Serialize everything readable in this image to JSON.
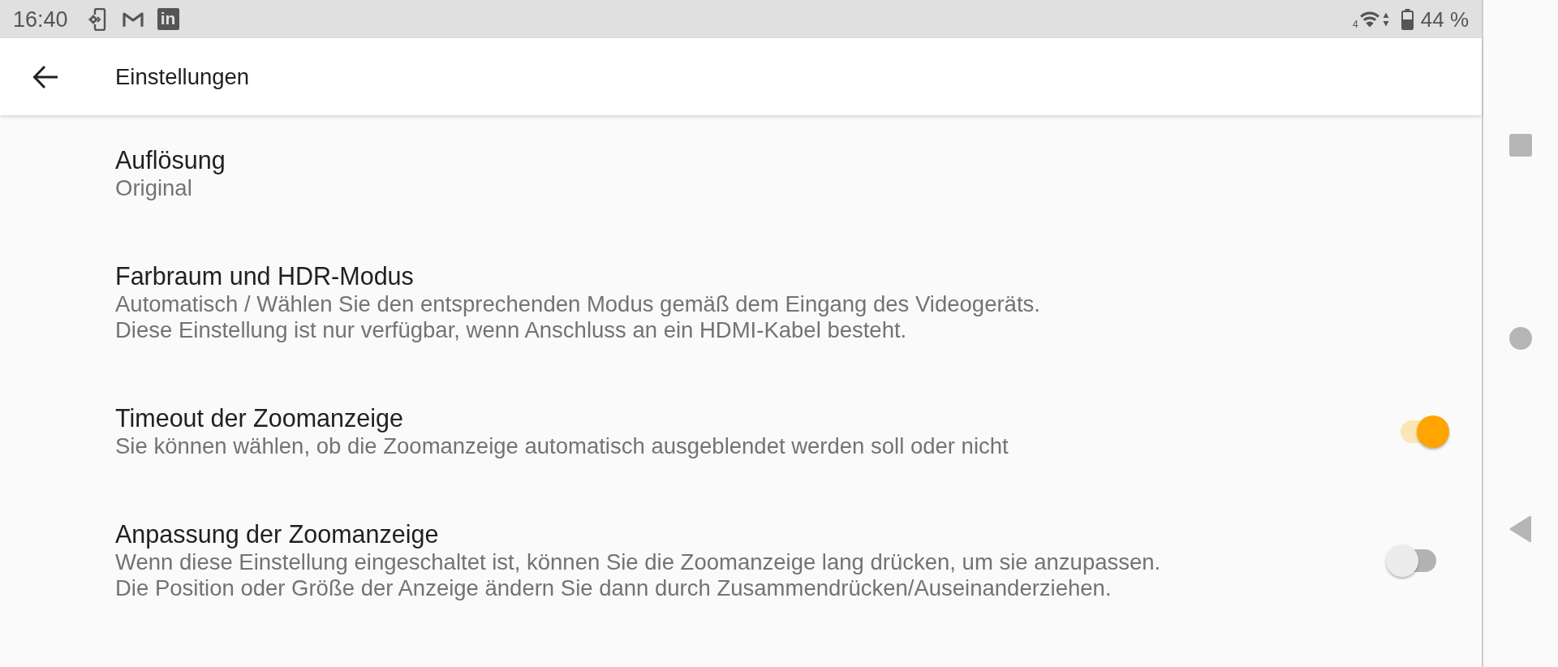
{
  "status_bar": {
    "time": "16:40",
    "logo_tile_text": "in",
    "network_type": "4",
    "battery_text": "44 %"
  },
  "app_bar": {
    "title": "Einstellungen"
  },
  "settings": [
    {
      "kind": "value",
      "title": "Auflösung",
      "lines": [
        "Original"
      ]
    },
    {
      "kind": "value",
      "title": "Farbraum und HDR-Modus",
      "lines": [
        "Automatisch / Wählen Sie den entsprechenden Modus gemäß dem Eingang des Videogeräts.",
        "Diese Einstellung ist nur verfügbar, wenn Anschluss an ein HDMI-Kabel besteht."
      ]
    },
    {
      "kind": "toggle",
      "title": "Timeout der Zoomanzeige",
      "lines": [
        "Sie können wählen, ob die Zoomanzeige automatisch ausgeblendet werden soll oder nicht"
      ],
      "checked": true
    },
    {
      "kind": "toggle",
      "title": "Anpassung der Zoomanzeige",
      "lines": [
        "Wenn diese Einstellung eingeschaltet ist, können Sie die Zoomanzeige lang drücken, um sie anzupassen.",
        "Die Position oder Größe der Anzeige ändern Sie dann durch Zusammendrücken/Auseinanderziehen."
      ],
      "checked": false
    }
  ]
}
